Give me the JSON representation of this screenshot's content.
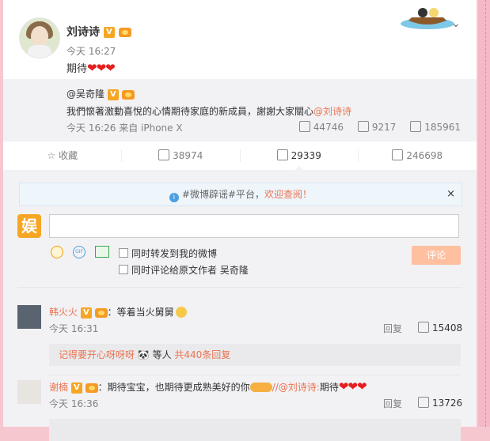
{
  "post": {
    "author": "刘诗诗",
    "time": "今天 16:27",
    "text": "期待",
    "hearts": "❤❤❤"
  },
  "retweet": {
    "author": "@吴奇隆",
    "text": "我們懷著激動喜悅的心情期待家庭的新成員，謝謝大家關心",
    "mention": "@刘诗诗",
    "time_source": "今天 16:26 来自 iPhone X",
    "reposts": "44746",
    "comments": "9217",
    "likes": "185961"
  },
  "actions": {
    "favorite": "收藏",
    "repost": "38974",
    "comment": "29339",
    "like": "246698"
  },
  "notice": {
    "prefix": "#微博辟谣#平台，",
    "link": "欢迎查阅！",
    "close": "×"
  },
  "composer": {
    "logo": "娱",
    "gif_label": "GIF",
    "opt1": "同时转发到我的微博",
    "opt2": "同时评论给原文作者 吴奇隆",
    "submit": "评论"
  },
  "comments": [
    {
      "name": "韩火火",
      "text": "：等着当火舅舅",
      "time": "今天 16:31",
      "reply": "回复",
      "likes": "15408",
      "sub_reply_user": "记得要开心呀呀呀",
      "sub_reply_mid": " 🐼 等人 ",
      "sub_reply_count": "共440条回复"
    },
    {
      "name": "谢楠",
      "text": "：期待宝宝，也期待更成熟美好的你",
      "mention": "//@刘诗诗:",
      "text2": "期待",
      "hearts": "❤❤❤",
      "time": "今天 16:36",
      "reply": "回复",
      "likes": "13726"
    }
  ]
}
